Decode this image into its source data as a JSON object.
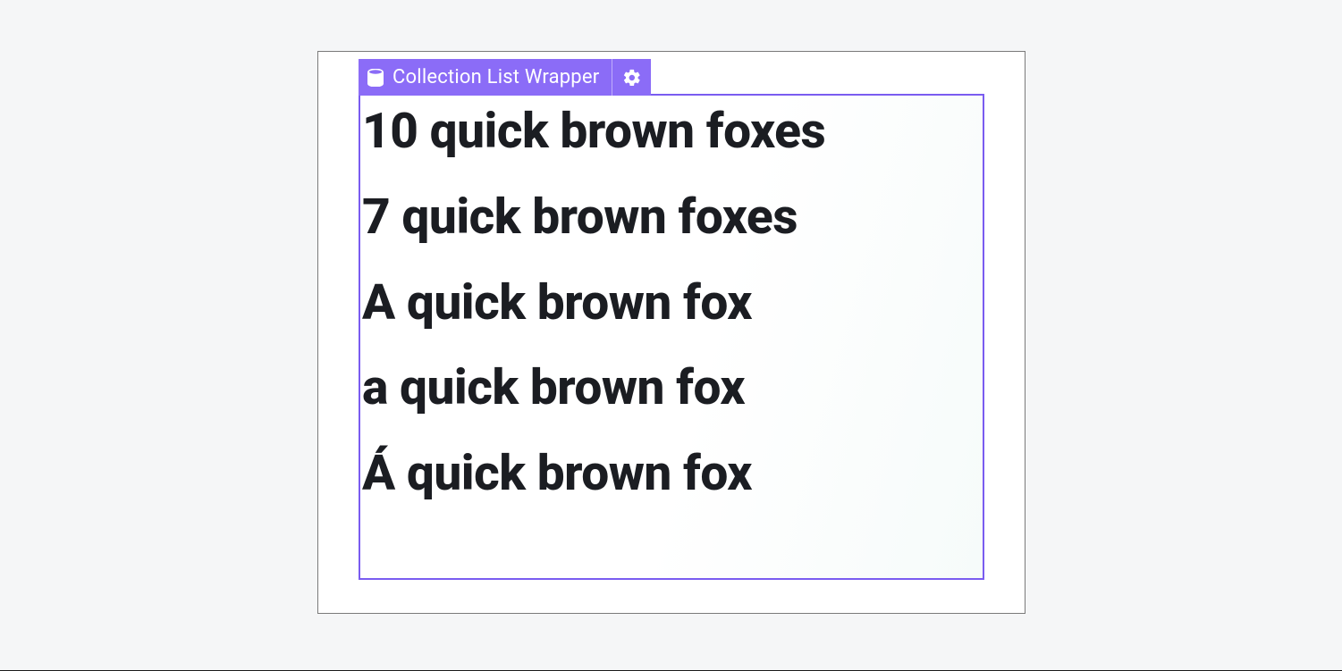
{
  "element_tag": {
    "label": "Collection List Wrapper"
  },
  "collection_items": [
    "10 quick brown foxes",
    "7 quick brown foxes",
    "A quick brown fox",
    "a quick brown fox",
    "Á quick brown fox"
  ],
  "colors": {
    "selection": "#7a5cf0",
    "tag_bg": "#8b6cf7",
    "text": "#1b1d22"
  }
}
